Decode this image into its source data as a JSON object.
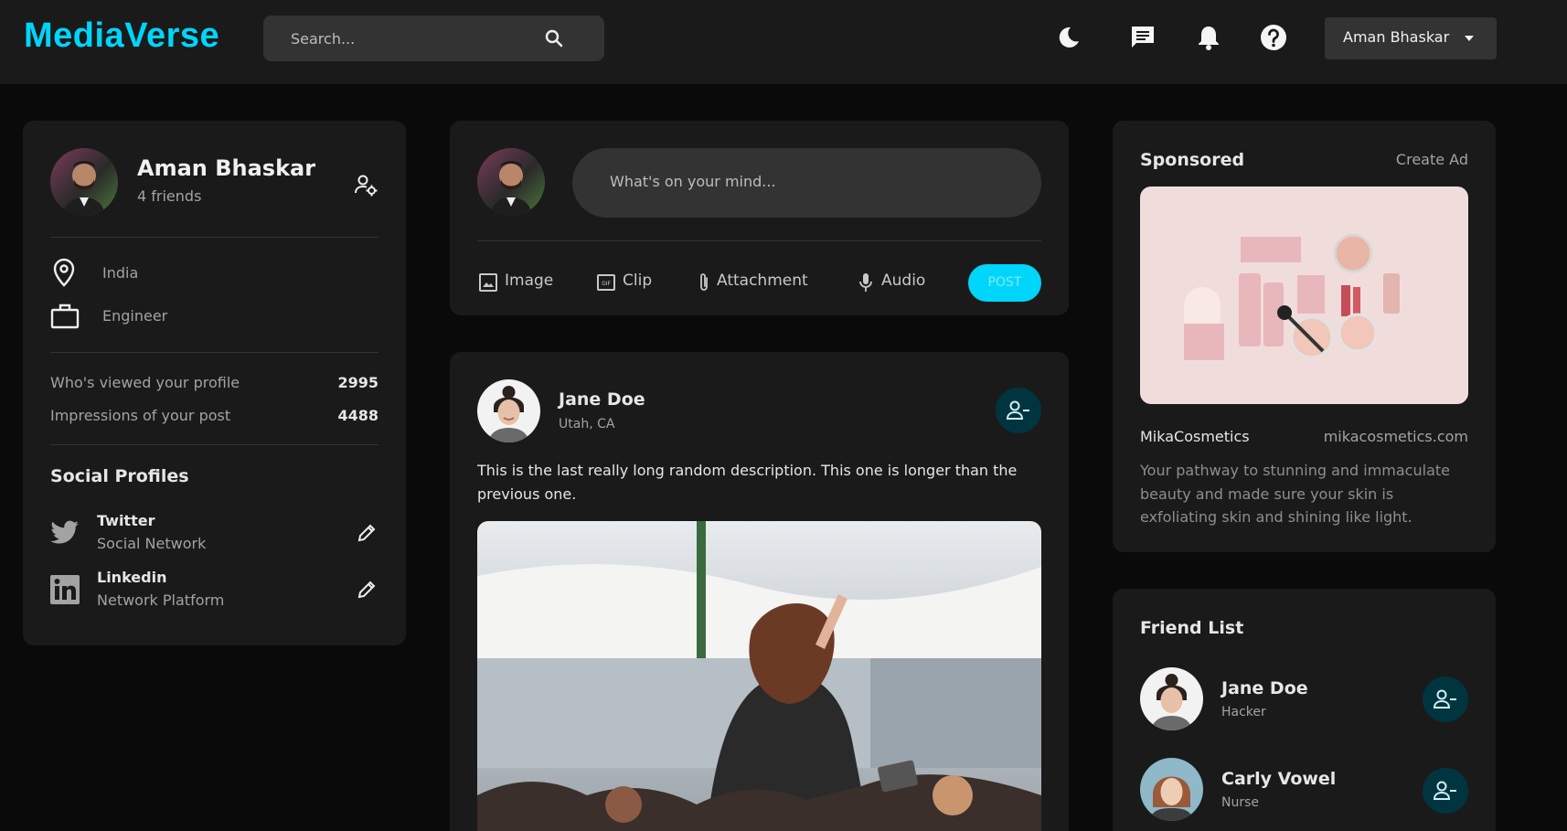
{
  "app": {
    "logo": "MediaVerse"
  },
  "header": {
    "search_placeholder": "Search...",
    "user_name": "Aman Bhaskar",
    "icons": [
      "moon-icon",
      "chat-icon",
      "bell-icon",
      "help-icon"
    ]
  },
  "colors": {
    "accent": "#00d5fa",
    "card": "#1a1a1a",
    "background": "#0a0a0a",
    "action_bg": "#00353f"
  },
  "profile": {
    "name": "Aman Bhaskar",
    "friends": "4 friends",
    "location": "India",
    "occupation": "Engineer",
    "stats": [
      {
        "label": "Who's viewed your profile",
        "value": "2995"
      },
      {
        "label": "Impressions of your post",
        "value": "4488"
      }
    ],
    "social_title": "Social Profiles",
    "socials": [
      {
        "name": "Twitter",
        "type": "Social Network",
        "icon": "twitter-icon"
      },
      {
        "name": "Linkedin",
        "type": "Network Platform",
        "icon": "linkedin-icon"
      }
    ]
  },
  "composer": {
    "placeholder": "What's on your mind...",
    "actions": [
      {
        "label": "Image",
        "icon": "image-icon"
      },
      {
        "label": "Clip",
        "icon": "gif-icon"
      },
      {
        "label": "Attachment",
        "icon": "paperclip-icon"
      },
      {
        "label": "Audio",
        "icon": "microphone-icon"
      }
    ],
    "post_label": "POST"
  },
  "post": {
    "author": "Jane Doe",
    "location": "Utah, CA",
    "description": "This is the last really long random description. This one is longer than the previous one."
  },
  "sponsored": {
    "title": "Sponsored",
    "create_ad": "Create Ad",
    "brand": "MikaCosmetics",
    "url": "mikacosmetics.com",
    "description": "Your pathway to stunning and immaculate beauty and made sure your skin is exfoliating skin and shining like light."
  },
  "friend_list": {
    "title": "Friend List",
    "friends": [
      {
        "name": "Jane Doe",
        "role": "Hacker"
      },
      {
        "name": "Carly Vowel",
        "role": "Nurse"
      }
    ]
  }
}
